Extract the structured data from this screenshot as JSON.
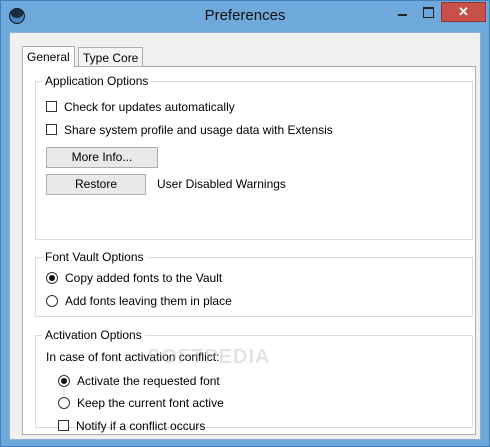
{
  "window": {
    "title": "Preferences",
    "close_glyph": "✕"
  },
  "tabs": [
    {
      "label": "General",
      "selected": true
    },
    {
      "label": "Type Core",
      "selected": false
    }
  ],
  "application_options": {
    "title": "Application Options",
    "check_updates": {
      "label": "Check for updates automatically",
      "checked": false
    },
    "share_profile": {
      "label": "Share system profile and usage data with Extensis",
      "checked": false
    },
    "more_info_button": "More Info...",
    "restore_button": "Restore",
    "restore_description": "User Disabled Warnings"
  },
  "font_vault_options": {
    "title": "Font Vault Options",
    "options": [
      {
        "label": "Copy added fonts to the Vault",
        "selected": true
      },
      {
        "label": "Add fonts leaving them in place",
        "selected": false
      }
    ]
  },
  "activation_options": {
    "title": "Activation Options",
    "conflict_label": "In case of font activation conflict:",
    "options": [
      {
        "label": "Activate the requested font",
        "selected": true
      },
      {
        "label": "Keep the current font active",
        "selected": false
      }
    ],
    "notify": {
      "label": "Notify if a conflict occurs",
      "checked": false
    }
  },
  "watermark": "SOFTPEDIA",
  "colors": {
    "window_frame": "#6fa9dc",
    "close_button": "#c7504a",
    "panel": "#ffffff"
  }
}
